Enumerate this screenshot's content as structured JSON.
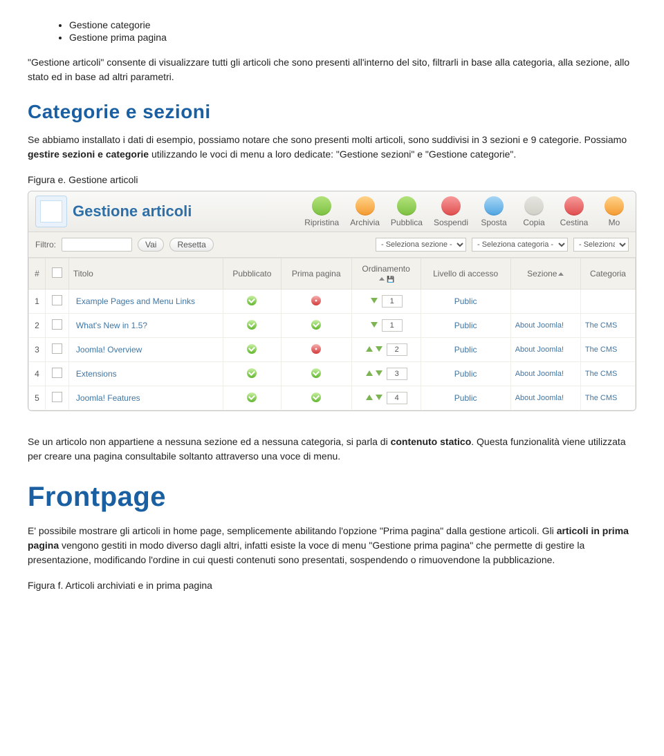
{
  "bullets": [
    "Gestione categorie",
    "Gestione prima pagina"
  ],
  "paragraphs": {
    "intro": "\"Gestione articoli\" consente di visualizzare tutti gli articoli che sono presenti all'interno del sito, filtrarli in base alla categoria, alla sezione, allo stato ed in base ad altri parametri.",
    "cat_title": "Categorie e sezioni",
    "cat_body_a": "Se abbiamo installato i dati di esempio, possiamo notare che sono presenti molti articoli, sono suddivisi in 3 sezioni e 9 categorie. Possiamo ",
    "cat_body_b": "gestire sezioni e categorie",
    "cat_body_c": " utilizzando le voci di menu a loro dedicate: \"Gestione sezioni\" e \"Gestione categorie\".",
    "fig_e": "Figura e. Gestione articoli",
    "after_a": "Se un articolo non appartiene a nessuna sezione ed a nessuna categoria, si parla di ",
    "after_b": "contenuto statico",
    "after_c": ". Questa funzionalità viene utilizzata per creare una pagina consultabile soltanto attraverso una voce di menu.",
    "fp_title": "Frontpage",
    "fp_body_a": "E' possibile mostrare gli articoli in home page, semplicemente abilitando l'opzione \"Prima pagina\" dalla gestione articoli. Gli ",
    "fp_body_b": "articoli in prima pagina",
    "fp_body_c": " vengono gestiti in modo diverso dagli altri, infatti esiste la voce di menu \"Gestione prima pagina\" che permette di gestire la presentazione, modificando l'ordine in cui questi contenuti sono presentati, sospendendo o rimuovendone la pubblicazione.",
    "fig_f": "Figura f. Articoli archiviati e in prima pagina"
  },
  "ui": {
    "title": "Gestione articoli",
    "tools": [
      "Ripristina",
      "Archivia",
      "Pubblica",
      "Sospendi",
      "Sposta",
      "Copia",
      "Cestina",
      "Mo"
    ],
    "tool_colors": {
      "Ripristina": "green",
      "Archivia": "orange",
      "Pubblica": "green",
      "Sospendi": "red",
      "Sposta": "blue",
      "Copia": "gray",
      "Cestina": "red",
      "Mo": "orange"
    },
    "filter_label": "Filtro:",
    "btn_vai": "Vai",
    "btn_reset": "Resetta",
    "sel_sezione": "- Seleziona sezione -",
    "sel_categoria": "- Seleziona categoria -",
    "sel_ultimo": "- Seleziona u",
    "columns": {
      "n": "#",
      "cb": "",
      "titolo": "Titolo",
      "pubblicato": "Pubblicato",
      "prima": "Prima pagina",
      "ord": "Ordinamento",
      "liv": "Livello di accesso",
      "sez": "Sezione",
      "cat": "Categoria"
    },
    "rows": [
      {
        "n": "1",
        "titolo": "Example Pages and Menu Links",
        "pub": true,
        "prima": false,
        "ord": "1",
        "up": false,
        "down": true,
        "liv": "Public",
        "sez": "",
        "cat": ""
      },
      {
        "n": "2",
        "titolo": "What's New in 1.5?",
        "pub": true,
        "prima": true,
        "ord": "1",
        "up": false,
        "down": true,
        "liv": "Public",
        "sez": "About Joomla!",
        "cat": "The CMS"
      },
      {
        "n": "3",
        "titolo": "Joomla! Overview",
        "pub": true,
        "prima": false,
        "ord": "2",
        "up": true,
        "down": true,
        "liv": "Public",
        "sez": "About Joomla!",
        "cat": "The CMS"
      },
      {
        "n": "4",
        "titolo": "Extensions",
        "pub": true,
        "prima": true,
        "ord": "3",
        "up": true,
        "down": true,
        "liv": "Public",
        "sez": "About Joomla!",
        "cat": "The CMS"
      },
      {
        "n": "5",
        "titolo": "Joomla! Features",
        "pub": true,
        "prima": true,
        "ord": "4",
        "up": true,
        "down": true,
        "liv": "Public",
        "sez": "About Joomla!",
        "cat": "The CMS"
      }
    ]
  }
}
